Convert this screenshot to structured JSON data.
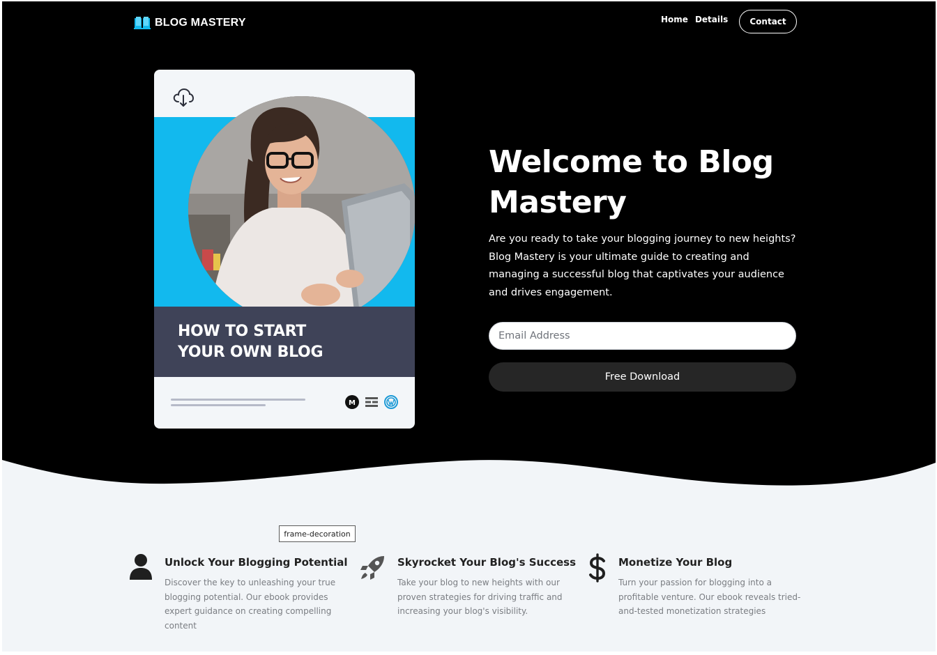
{
  "brand": {
    "name": "BLOG MASTERY",
    "accent": "#12b9ee"
  },
  "nav": {
    "links": [
      {
        "label": "Home"
      },
      {
        "label": "Details"
      }
    ],
    "contact_label": "Contact"
  },
  "book": {
    "title_lines": [
      "HOW TO START",
      "YOUR OWN BLOG"
    ],
    "icons": [
      "cloud-download-icon",
      "medium-icon",
      "substack-icon",
      "wordpress-icon"
    ],
    "medium_letter": "M"
  },
  "hero": {
    "title": "Welcome to Blog Mastery",
    "description": "Are you ready to take your blogging journey to new heights? Blog Mastery is your ultimate guide to creating and managing a successful blog that captivates your audience and drives engagement.",
    "email_placeholder": "Email Address",
    "email_value": "",
    "button_label": "Free Download"
  },
  "frame_tag": "frame-decoration",
  "features": [
    {
      "icon": "user-icon",
      "title": "Unlock Your Blogging Potential",
      "description": "Discover the key to unleashing your true blogging potential. Our ebook provides expert guidance on creating compelling content"
    },
    {
      "icon": "rocket-icon",
      "title": "Skyrocket Your Blog's Success",
      "description": "Take your blog to new heights with our proven strategies for driving traffic and increasing your blog's visibility."
    },
    {
      "icon": "dollar-icon",
      "title": "Monetize Your Blog",
      "description": "Turn your passion for blogging into a profitable venture. Our ebook reveals tried-and-tested monetization strategies"
    }
  ],
  "colors": {
    "hero_bg": "#000000",
    "section_bg": "#f2f5f8",
    "book_bar": "#3f4358",
    "button_bg": "#262626"
  }
}
